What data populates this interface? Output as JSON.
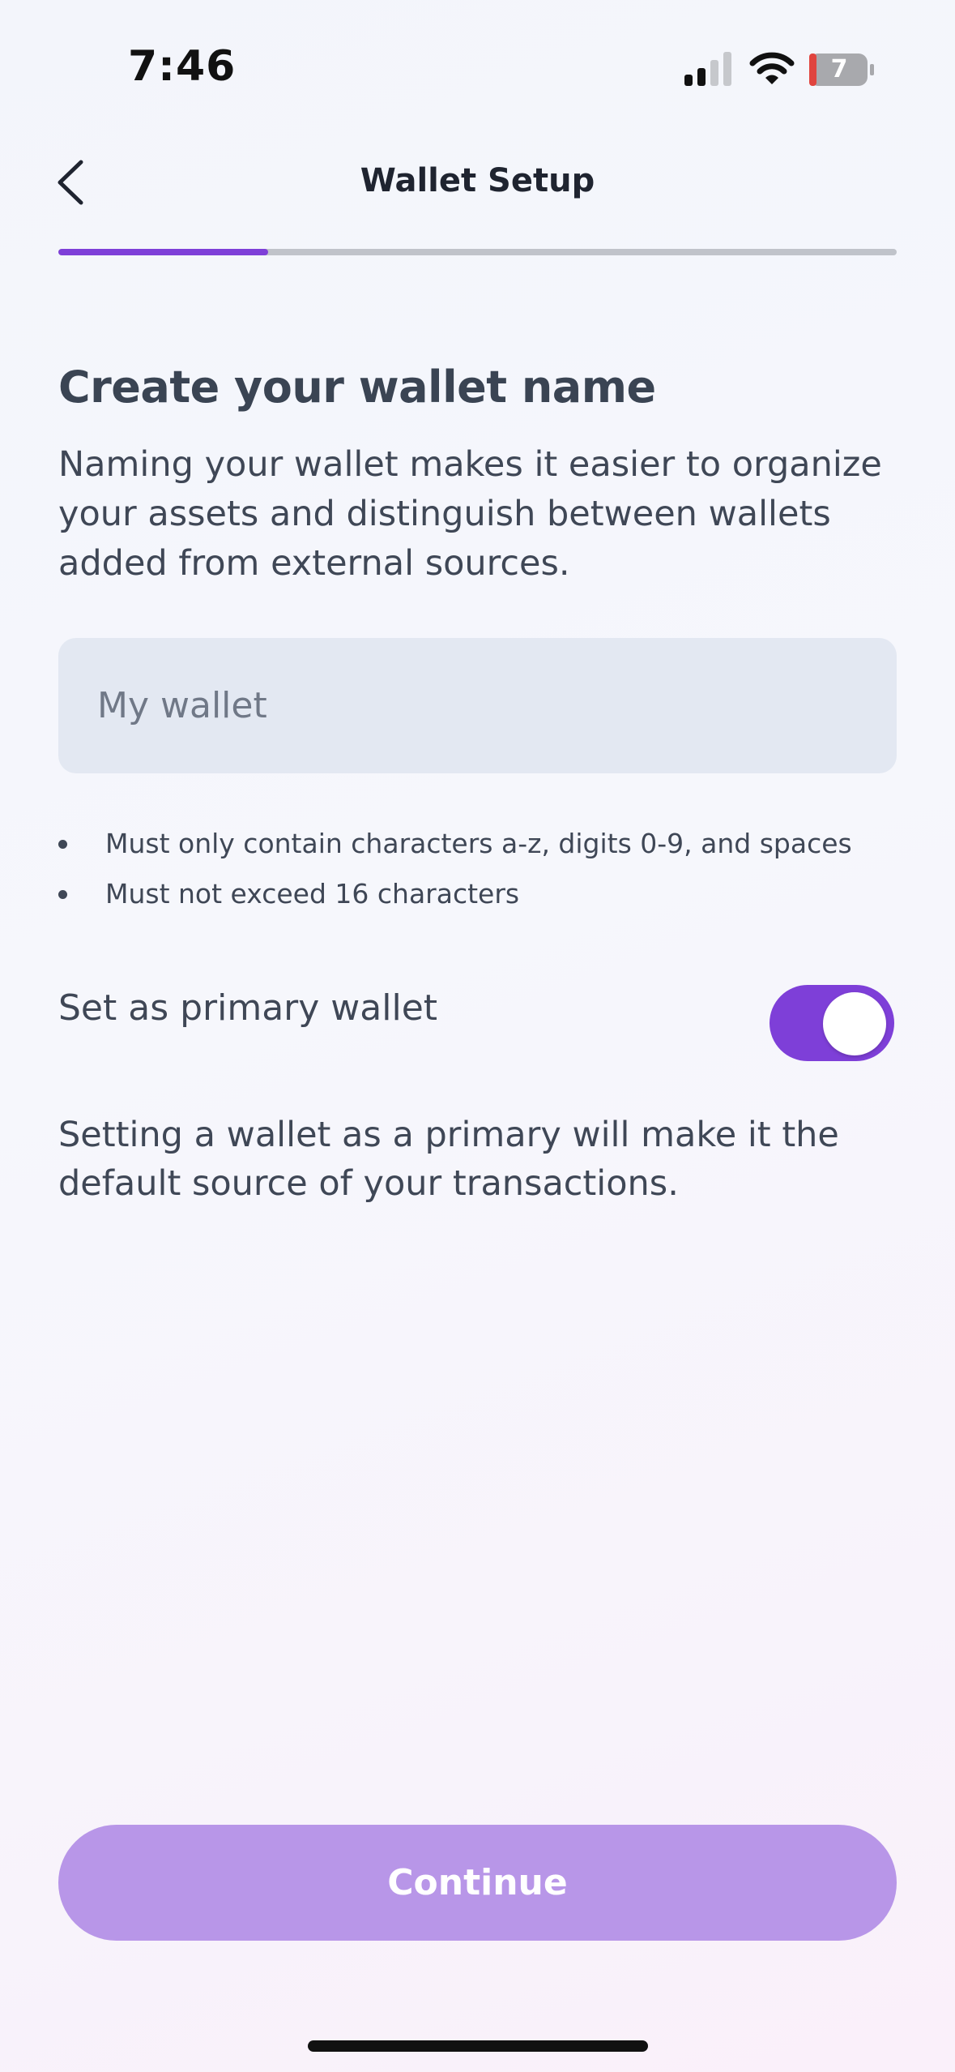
{
  "status_bar": {
    "time": "7:46",
    "battery": "7",
    "icons": [
      "signal-icon",
      "wifi-icon",
      "battery-icon"
    ]
  },
  "header": {
    "title": "Wallet Setup",
    "back_icon": "chevron-left-icon"
  },
  "progress": {
    "fraction": 0.25,
    "fill_color": "#7e3fd8",
    "track_color": "#c0c3ca"
  },
  "main": {
    "heading": "Create your wallet name",
    "description": "Naming your wallet makes it easier to organize your assets and distinguish between wallets added from external sources.",
    "name_input": {
      "value": "",
      "placeholder": "My wallet"
    },
    "rules": [
      "Must only contain characters a-z, digits 0-9, and spaces",
      "Must not exceed 16 characters"
    ],
    "primary_toggle": {
      "label": "Set as primary wallet",
      "on": true
    },
    "primary_note": "Setting a wallet as a primary will make it the default source of your transactions."
  },
  "footer": {
    "continue_label": "Continue"
  },
  "colors": {
    "accent": "#7e3fd8",
    "button_disabled": "#b896e8",
    "input_background": "#e3e8f2",
    "text_primary": "#3a4453"
  }
}
